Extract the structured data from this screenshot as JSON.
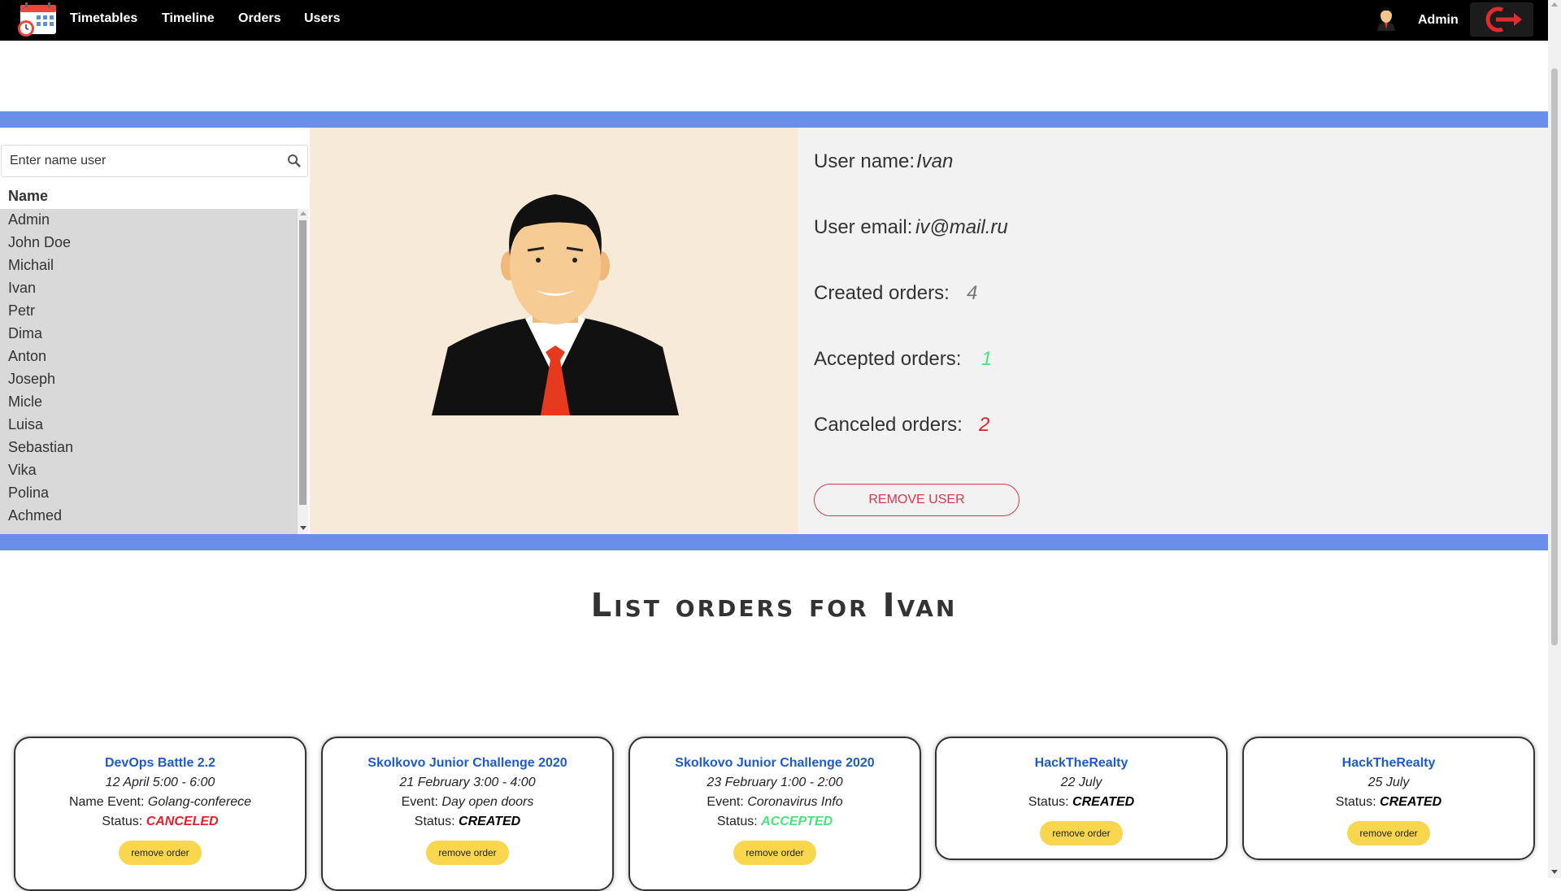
{
  "nav": {
    "links": [
      "Timetables",
      "Timeline",
      "Orders",
      "Users"
    ],
    "user_name": "Admin"
  },
  "search": {
    "placeholder": "Enter name user"
  },
  "users_table": {
    "header": "Name",
    "rows": [
      "Admin",
      "John Doe",
      "Michail",
      "Ivan",
      "Petr",
      "Dima",
      "Anton",
      "Joseph",
      "Micle",
      "Luisa",
      "Sebastian",
      "Vika",
      "Polina",
      "Achmed"
    ]
  },
  "user_info": {
    "name_label": "User name:",
    "name_value": "Ivan",
    "email_label": "User email:",
    "email_value": "iv@mail.ru",
    "created_label": "Created orders:",
    "created_value": "4",
    "accepted_label": "Accepted orders:",
    "accepted_value": "1",
    "canceled_label": "Canceled orders:",
    "canceled_value": "2",
    "remove_button": "REMOVE USER"
  },
  "orders_title": "List orders for  Ivan",
  "orders": [
    {
      "title": "DevOps Battle 2.2",
      "date": "12 April 5:00 - 6:00",
      "event_label": "Name Event:",
      "event": "Golang-conferece",
      "status_label": "Status:",
      "status": "CANCELED",
      "remove": "remove order"
    },
    {
      "title": "Skolkovo Junior Challenge 2020",
      "date": "21 February 3:00 - 4:00",
      "event_label": "Event:",
      "event": "Day open doors",
      "status_label": "Status:",
      "status": "CREATED",
      "remove": "remove order"
    },
    {
      "title": "Skolkovo Junior Challenge 2020",
      "date": "23 February 1:00 - 2:00",
      "event_label": "Event:",
      "event": "Coronavirus Info",
      "status_label": "Status:",
      "status": "ACCEPTED",
      "remove": "remove order"
    },
    {
      "title": "HackTheRealty",
      "date": "22 July",
      "status_label": "Status:",
      "status": "CREATED",
      "remove": "remove order"
    },
    {
      "title": "HackTheRealty",
      "date": "25 July",
      "status_label": "Status:",
      "status": "CREATED",
      "remove": "remove order"
    }
  ],
  "colors": {
    "navbar": "#000000",
    "accent_blue": "#6b8fe8",
    "avatar_bg": "#f8ead8",
    "info_bg": "#f2f2f2",
    "canceled": "#e0202c",
    "accepted": "#4fe07c",
    "link_blue": "#1e5bc6",
    "remove_order_bg": "#f8d64e"
  },
  "icons": {
    "logo": "calendar-clock-icon",
    "nav_avatar": "user-avatar-icon",
    "logout": "logout-arrow-icon",
    "search": "search-icon"
  }
}
